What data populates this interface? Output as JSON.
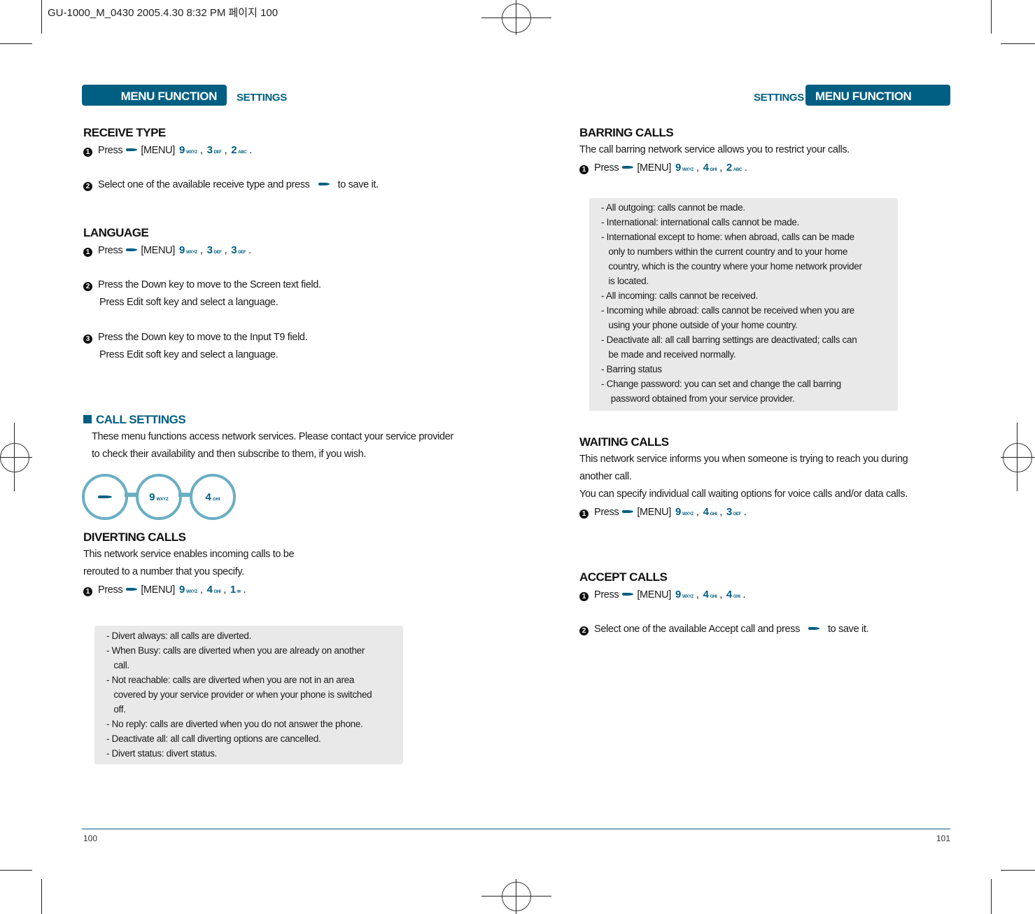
{
  "print_slug": "GU-1000_M_0430  2005.4.30 8:32 PM 페이지 100",
  "colors": {
    "brand": "#005e82",
    "circle": "#6aaec3",
    "box": "#e9e9e9"
  },
  "left": {
    "tab_label": "MENU FUNCTION",
    "section_label": "SETTINGS",
    "receive_type": {
      "title": "RECEIVE TYPE",
      "step1": {
        "num": "1",
        "press": "Press",
        "menu": "[MENU]",
        "keys": [
          [
            "9",
            "WXYZ"
          ],
          [
            "3",
            "DEF"
          ],
          [
            "2",
            "ABC"
          ]
        ]
      },
      "step2": {
        "num": "2",
        "text": "Select one of the available receive type and press",
        "suffix": "to save it."
      }
    },
    "language": {
      "title": "LANGUAGE",
      "step1": {
        "num": "1",
        "press": "Press",
        "menu": "[MENU]",
        "keys": [
          [
            "9",
            "WXYZ"
          ],
          [
            "3",
            "DEF"
          ],
          [
            "3",
            "DEF"
          ]
        ]
      },
      "step2": {
        "num": "2",
        "line1": "Press the Down key to move to the Screen text field.",
        "line2": "Press Edit soft key and select a language."
      },
      "step3": {
        "num": "3",
        "line1": "Press the Down key to move to the Input T9 field.",
        "line2": "Press Edit soft key and select a language."
      }
    },
    "call_settings": {
      "title": "CALL SETTINGS",
      "line1": "These menu functions access network services. Please contact your service provider",
      "line2": "to check their availability and then subscribe to them, if you wish.",
      "path_keys": [
        [
          "9",
          "WXYZ"
        ],
        [
          "4",
          "GHI"
        ]
      ]
    },
    "diverting": {
      "title": "DIVERTING CALLS",
      "line1": "This network service enables incoming calls to be",
      "line2": "rerouted to a number that you specify.",
      "step1": {
        "num": "1",
        "press": "Press",
        "menu": "[MENU]",
        "keys": [
          [
            "9",
            "WXYZ"
          ],
          [
            "4",
            "GHI"
          ],
          [
            "1",
            "✉"
          ]
        ]
      },
      "box": [
        "- Divert always: all calls are diverted.",
        "- When Busy: calls are diverted when you are already on another",
        "   call.",
        "- Not reachable: calls are diverted when you are not in an area",
        "   covered by your service provider or when your phone is switched",
        "   off.",
        "- No reply: calls are diverted when you do not answer the phone.",
        "- Deactivate all: all call diverting options are cancelled.",
        "- Divert status: divert status."
      ]
    },
    "page_number": "100"
  },
  "right": {
    "tab_label": "MENU FUNCTION",
    "section_label": "SETTINGS",
    "barring": {
      "title": "BARRING CALLS",
      "line1": "The call barring network service allows you to restrict your calls.",
      "step1": {
        "num": "1",
        "press": "Press",
        "menu": "[MENU]",
        "keys": [
          [
            "9",
            "WXYZ"
          ],
          [
            "4",
            "GHI"
          ],
          [
            "2",
            "ABC"
          ]
        ]
      },
      "box": [
        "- All outgoing: calls cannot be made.",
        "- International: international calls cannot be made.",
        "- International except to home: when abroad, calls can be made",
        "   only to numbers within the current country and to your home",
        "   country, which is the country where your home network provider",
        "   is located.",
        "- All incoming: calls cannot be received.",
        "- Incoming while abroad: calls cannot be received when you are",
        "   using your phone outside of your home country.",
        "- Deactivate all: all call barring settings are deactivated; calls can",
        "   be made and received normally.",
        "- Barring status",
        "- Change password: you can set and change the call barring",
        "    password obtained from your service provider."
      ]
    },
    "waiting": {
      "title": "WAITING CALLS",
      "line1": "This network service informs you when someone is trying to reach you during",
      "line2": "another call.",
      "line3": "You can specify individual call waiting options for voice calls and/or data calls.",
      "step1": {
        "num": "1",
        "press": "Press",
        "menu": "[MENU]",
        "keys": [
          [
            "9",
            "WXYZ"
          ],
          [
            "4",
            "GHI"
          ],
          [
            "3",
            "DEF"
          ]
        ]
      }
    },
    "accept": {
      "title": "ACCEPT CALLS",
      "step1": {
        "num": "1",
        "press": "Press",
        "menu": "[MENU]",
        "keys": [
          [
            "9",
            "WXYZ"
          ],
          [
            "4",
            "GHI"
          ],
          [
            "4",
            "GHI"
          ]
        ]
      },
      "step2": {
        "num": "2",
        "text": "Select one of the available Accept call and press",
        "suffix": "to save it."
      }
    },
    "page_number": "101"
  }
}
